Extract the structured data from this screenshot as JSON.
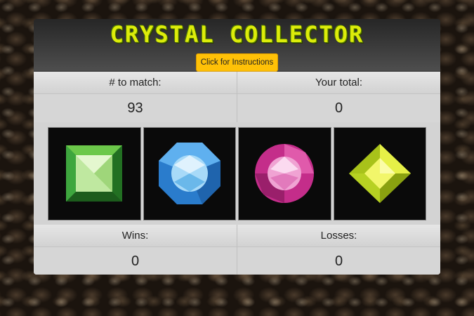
{
  "title": "CRYSTAL COLLECTOR",
  "instructions_button": "Click for Instructions",
  "target": {
    "label": "# to match:",
    "value": "93"
  },
  "total": {
    "label": "Your total:",
    "value": "0"
  },
  "wins": {
    "label": "Wins:",
    "value": "0"
  },
  "losses": {
    "label": "Losses:",
    "value": "0"
  },
  "crystals": [
    {
      "name": "green-crystal",
      "color": "#3fa33f"
    },
    {
      "name": "blue-crystal",
      "color": "#3a93e0"
    },
    {
      "name": "pink-crystal",
      "color": "#d6389a"
    },
    {
      "name": "yellow-crystal",
      "color": "#c8e014"
    }
  ]
}
